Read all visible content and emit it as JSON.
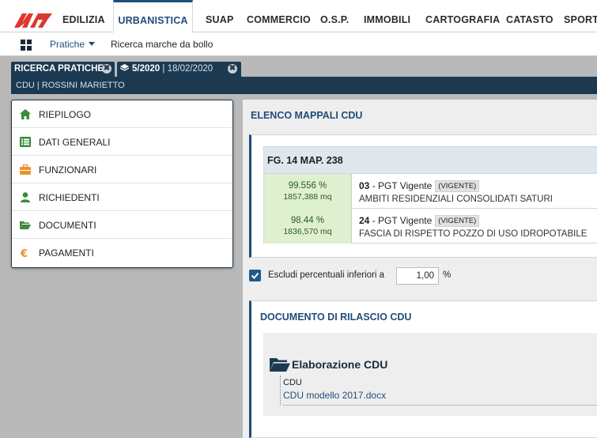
{
  "nav": {
    "tabs": [
      "EDILIZIA",
      "URBANISTICA",
      "SUAP",
      "COMMERCIO",
      "O.S.P.",
      "IMMOBILI",
      "CARTOGRAFIA",
      "CATASTO",
      "SPORTE"
    ],
    "active_index": 1,
    "logo_colors": [
      "#e3342f",
      "#d63a30"
    ]
  },
  "subnav": {
    "menu_label": "Pratiche",
    "link_label": "Ricerca marche da bollo"
  },
  "record_tabs": {
    "search_tab": "RICERCA PRATICHE",
    "record_number": "5/2020",
    "record_date": "18/02/2020",
    "close_glyph": "✖"
  },
  "breadcrumb": "CDU | ROSSINI MARIETTO",
  "left_menu": [
    {
      "label": "RIEPILOGO",
      "icon": "home-icon",
      "color": "#3a8a3a"
    },
    {
      "label": "DATI GENERALI",
      "icon": "list-icon",
      "color": "#3a8a3a"
    },
    {
      "label": "FUNZIONARI",
      "icon": "briefcase-icon",
      "color": "#e8942a"
    },
    {
      "label": "RICHIEDENTI",
      "icon": "user-icon",
      "color": "#3a8a3a"
    },
    {
      "label": "DOCUMENTI",
      "icon": "folder-open-icon",
      "color": "#3a8a3a"
    },
    {
      "label": "PAGAMENTI",
      "icon": "euro-icon",
      "color": "#e8942a"
    }
  ],
  "main": {
    "title": "ELENCO MAPPALI CDU",
    "parcel_header": "FG. 14 MAP. 238",
    "parcel_rows": [
      {
        "percent": "99.556 %",
        "area": "1857,388 mq",
        "code": "03",
        "plan": " - PGT Vigente",
        "badge": "(VIGENTE)",
        "zone": "AMBITI RESIDENZIALI CONSOLIDATI SATURI"
      },
      {
        "percent": "98.44 %",
        "area": "1836,570 mq",
        "code": "24",
        "plan": " - PGT Vigente",
        "badge": "(VIGENTE)",
        "zone": "FASCIA DI RISPETTO POZZO DI USO IDROPOTABILE"
      }
    ],
    "filter_label": "Escludi percentuali inferiori a",
    "filter_value": "1,00",
    "filter_unit": "%",
    "filter_checked": true,
    "doc_section_title": "DOCUMENTO DI RILASCIO CDU",
    "doc_group_title": "Elaborazione CDU",
    "doc_category": "CDU",
    "doc_file": "CDU modello 2017.docx"
  }
}
